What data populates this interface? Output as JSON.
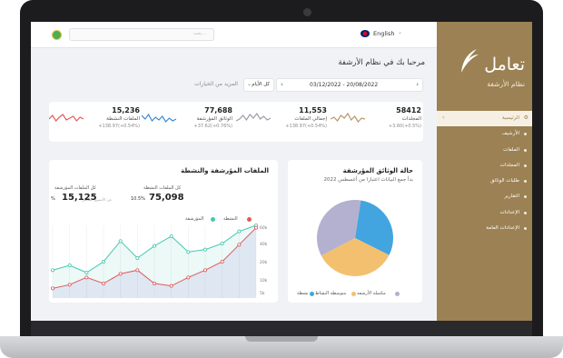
{
  "topbar": {
    "language": "English",
    "search_placeholder": "بحث..."
  },
  "sidebar": {
    "brand": "تعامل",
    "subtitle": "نظام الأرشفة",
    "items": [
      {
        "label": "الرئيسية",
        "active": true
      },
      {
        "label": "الأرشيف",
        "active": false
      },
      {
        "label": "الملفات",
        "active": false
      },
      {
        "label": "المجلدات",
        "active": false
      },
      {
        "label": "طلبات الوثائق",
        "active": false
      },
      {
        "label": "التقارير",
        "active": false
      },
      {
        "label": "الإعدادات",
        "active": false
      },
      {
        "label": "الإعدادات العامة",
        "active": false
      }
    ]
  },
  "header": {
    "greeting": "مرحبا بك في نظام الأرشفة",
    "date_range": "03/12/2022 - 20/08/2022",
    "period": "كل الأيام",
    "more_link": "المزيد من الخيارات"
  },
  "stats": [
    {
      "value": "58412",
      "label": "المجلدات",
      "delta": "+3.60(+0.5%)",
      "color": "#b9966a"
    },
    {
      "value": "11,553",
      "label": "إجمالي الملفات",
      "delta": "+138.97(+0.54%)",
      "color": "#9a9aa8"
    },
    {
      "value": "77,688",
      "label": "الوثائق المؤرشفة",
      "delta": "+37.62(+0.76%)",
      "color": "#3b8ad8"
    },
    {
      "value": "15,236",
      "label": "الملفات النشطة",
      "delta": "+138.97(+0.54%)",
      "color": "#e05a5a"
    }
  ],
  "pie_card": {
    "title": "حالة الوثائق المؤرشفة",
    "subtitle": "بدأ جمع البيانات اعتبارا من أغسطس 2022",
    "legend": [
      {
        "label": "مكتملة الأرشفة",
        "color": "#b3b1cf"
      },
      {
        "label": "متوسطة النشاط",
        "color": "#f3c06f"
      },
      {
        "label": "نشطة",
        "color": "#42a5e0"
      }
    ]
  },
  "line_card": {
    "title": "الملفات المؤرشفة والنشطة",
    "kpi1_value": "75,098",
    "kpi1_label": "كل الملفات النشطة",
    "kpi1_pct": "10.5%",
    "kpi1_note": "عن الأسبوع الماضي",
    "kpi2_value": "15,125",
    "kpi2_label": "كل الملفات المؤرشفة",
    "kpi2_pct": "%",
    "legend": [
      {
        "label": "النشطة",
        "color": "#e05a5a"
      },
      {
        "label": "المؤرشفة",
        "color": "#45c8b0"
      }
    ]
  },
  "chart_data": [
    {
      "type": "pie",
      "title": "حالة الوثائق المؤرشفة",
      "slices": [
        {
          "label": "نشطة",
          "value": 30,
          "color": "#42a5e0"
        },
        {
          "label": "متوسطة النشاط",
          "value": 35,
          "color": "#f3c06f"
        },
        {
          "label": "مكتملة الأرشفة",
          "value": 35,
          "color": "#b3b1cf"
        }
      ]
    },
    {
      "type": "line",
      "title": "الملفات المؤرشفة والنشطة",
      "ylim": [
        0,
        60
      ],
      "yticks": [
        "5k",
        "10k",
        "20k",
        "40k",
        "60k"
      ],
      "series": [
        {
          "name": "المؤرشفة",
          "color": "#45c8b0",
          "values": [
            23,
            27,
            21,
            30,
            47,
            33,
            43,
            51,
            38,
            40,
            45,
            55,
            60
          ]
        },
        {
          "name": "النشطة",
          "color": "#e05a5a",
          "values": [
            8,
            11,
            17,
            12,
            20,
            23,
            12,
            10,
            17,
            23,
            30,
            44,
            58
          ]
        }
      ]
    }
  ]
}
